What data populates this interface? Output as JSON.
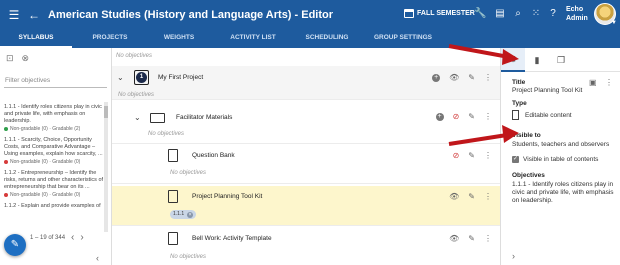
{
  "header": {
    "title": "American Studies (History and Language Arts) - Editor",
    "semester": "FALL SEMESTER",
    "user_line1": "Echo",
    "user_line2": "Admin",
    "icons": [
      "menu-icon",
      "back-arrow-icon",
      "calendar-icon",
      "wrench-icon",
      "document-icon",
      "search-icon",
      "apps-grid-icon",
      "help-icon"
    ]
  },
  "tabs": [
    "SYLLABUS",
    "PROJECTS",
    "WEIGHTS",
    "ACTIVITY LIST",
    "SCHEDULING",
    "GROUP SETTINGS"
  ],
  "left_panel": {
    "filter_placeholder": "Filter objectives",
    "objectives": [
      {
        "text": "1.1.1 - Identify roles citizens play in civic and private life, with emphasis on leadership.",
        "grade1": "Non-gradable (0)",
        "grade2": "Gradable (2)",
        "dot_color": "#2e9e4a"
      },
      {
        "text": "1.1.1 - Scarcity, Choice, Opportunity Costs, and Comparative Advantage – Using examples, explain how scarcity, ...",
        "grade1": "Non-gradable (0)",
        "grade2": "Gradable (0)",
        "dot_color": "#d63b3b"
      },
      {
        "text": "1.1.2 - Entrepreneurship – Identify the risks, returns and other characteristics of entrepreneurship that bear on its ...",
        "grade1": "Non-gradable (0)",
        "grade2": "Gradable (0)",
        "dot_color": "#d63b3b"
      },
      {
        "text": "1.1.2 - Explain and provide examples of",
        "grade1": "",
        "grade2": "",
        "dot_color": ""
      }
    ],
    "pager": "1 – 19 of 344"
  },
  "center": {
    "top_no_objectives": "No objectives",
    "rows": [
      {
        "name": "My First Project",
        "badge": "1",
        "objectives": "No objectives"
      },
      {
        "name": "Facilitator Materials",
        "objectives": "No objectives"
      },
      {
        "name": "Question Bank",
        "objectives": "No objectives"
      },
      {
        "name": "Project Planning Tool Kit",
        "tag": "1.1.1"
      },
      {
        "name": "Bell Work: Activity Template",
        "objectives": "No objectives"
      }
    ]
  },
  "right_panel": {
    "title_label": "Title",
    "title_value": "Project Planning Tool Kit",
    "type_label": "Type",
    "type_value": "Editable content",
    "visible_label": "Visible to",
    "visible_value": "Students, teachers and observers",
    "visible_toc": "Visible in table of contents",
    "objectives_label": "Objectives",
    "objectives_value": "1.1.1 - Identify roles citizens play in civic and private life, with emphasis on leadership."
  },
  "colors": {
    "brand": "#1e5b9e",
    "highlight_row": "#fdf6cc",
    "arrow": "#c0161a",
    "fab": "#1e6fc2"
  }
}
